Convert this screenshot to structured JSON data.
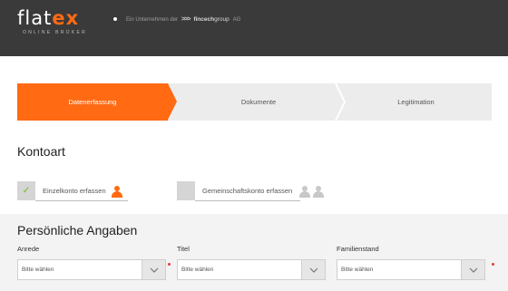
{
  "header": {
    "logo_main": "flat",
    "logo_accent": "ex",
    "logo_tagline": "ONLINE BROKER",
    "company_prefix": "Ein Unternehmen der",
    "company_arrows": ">>>",
    "company_brand": "fincech",
    "company_brand_light": "group",
    "company_suffix": "AG"
  },
  "steps": [
    {
      "label": "Datenerfassung",
      "active": true
    },
    {
      "label": "Dokumente",
      "active": false
    },
    {
      "label": "Legitimation",
      "active": false
    }
  ],
  "kontoart": {
    "title": "Kontoart",
    "options": [
      {
        "label": "Einzelkonto erfassen",
        "checked": true,
        "icon": "person-icon"
      },
      {
        "label": "Gemeinschaftskonto erfassen",
        "checked": false,
        "icon": "two-persons-icon"
      }
    ]
  },
  "personal": {
    "title": "Persönliche Angaben",
    "fields": [
      {
        "label": "Anrede",
        "placeholder": "Bitte wählen",
        "required": true
      },
      {
        "label": "Titel",
        "placeholder": "Bitte wählen",
        "required": false
      },
      {
        "label": "Familienstand",
        "placeholder": "Bitte wählen",
        "required": true
      }
    ]
  },
  "colors": {
    "accent": "#ff6a13",
    "header_bg": "#3a3a3a",
    "check": "#8bc34a",
    "required": "#e53935"
  }
}
